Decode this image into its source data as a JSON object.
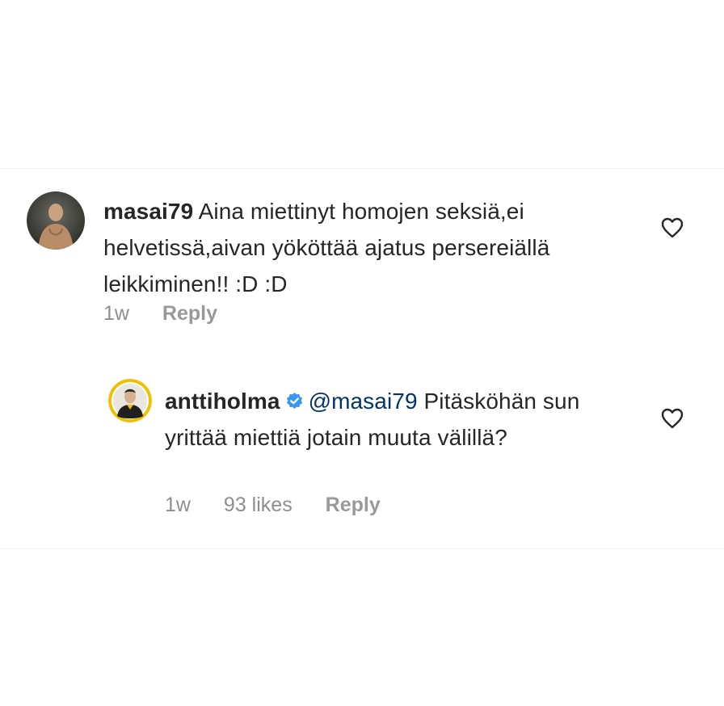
{
  "comments": [
    {
      "username": "masai79",
      "verified": false,
      "text": "Aina miettinyt homojen seksiä,ei helvetissä,aivan yököttää ajatus persereiällä leikkiminen!! :D :D",
      "time": "1w",
      "likes": "",
      "reply_label": "Reply",
      "avatar_icon": "profile-photo"
    },
    {
      "username": "anttiholma",
      "verified": true,
      "mention": "@masai79",
      "text": "Pitäsköhän sun yrittää miettiä jotain muuta välillä?",
      "time": "1w",
      "likes": "93 likes",
      "reply_label": "Reply",
      "avatar_icon": "profile-photo"
    }
  ],
  "colors": {
    "text": "#262626",
    "meta": "#8e8e8e",
    "mention": "#003569",
    "verified": "#3897f0",
    "avatar_ring": "#f0c000"
  },
  "icons": {
    "like": "heart-outline-icon",
    "verified": "verified-badge-icon"
  }
}
